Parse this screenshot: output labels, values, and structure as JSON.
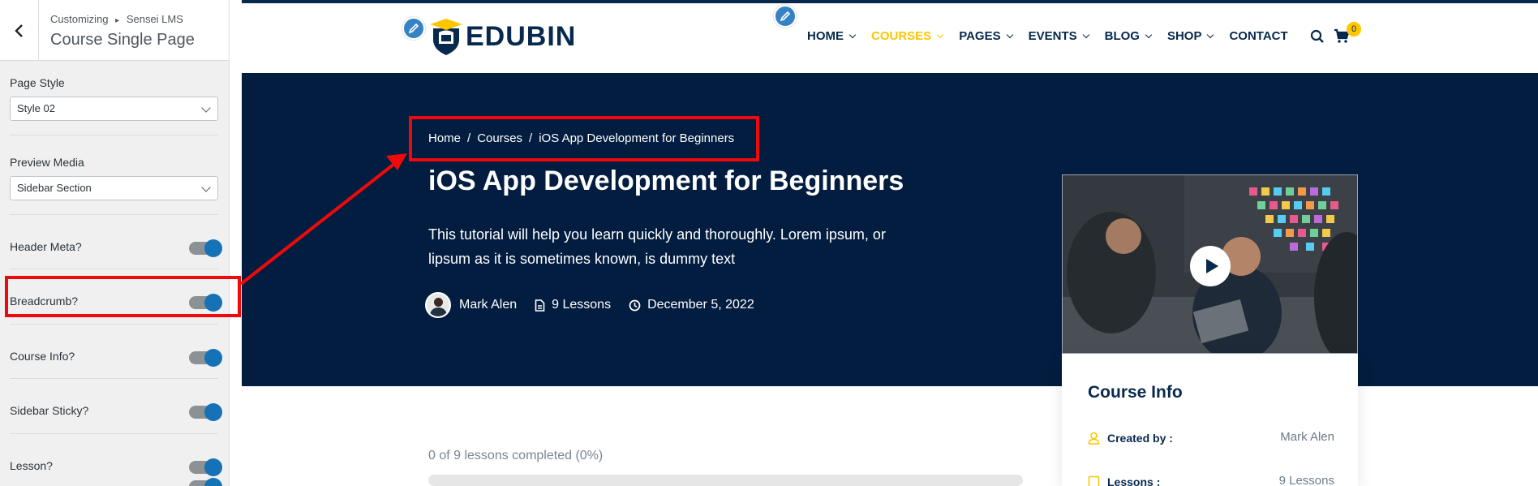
{
  "customizer": {
    "breadcrumb_parent": "Customizing",
    "breadcrumb_separator": "▸",
    "breadcrumb_section": "Sensei LMS",
    "title": "Course Single Page",
    "page_style": {
      "label": "Page Style",
      "value": "Style 02"
    },
    "preview_media": {
      "label": "Preview Media",
      "value": "Sidebar Section"
    },
    "toggles": [
      {
        "label": "Header Meta?",
        "on": true
      },
      {
        "label": "Breadcrumb?",
        "on": true
      },
      {
        "label": "Course Info?",
        "on": true
      },
      {
        "label": "Sidebar Sticky?",
        "on": true
      },
      {
        "label": "Lesson?",
        "on": true
      }
    ]
  },
  "site": {
    "logo_text": "EDUBIN",
    "nav": [
      {
        "label": "HOME",
        "dropdown": true,
        "active": false
      },
      {
        "label": "COURSES",
        "dropdown": true,
        "active": true
      },
      {
        "label": "PAGES",
        "dropdown": true,
        "active": false
      },
      {
        "label": "EVENTS",
        "dropdown": true,
        "active": false
      },
      {
        "label": "BLOG",
        "dropdown": true,
        "active": false
      },
      {
        "label": "SHOP",
        "dropdown": true,
        "active": false
      },
      {
        "label": "CONTACT",
        "dropdown": false,
        "active": false
      }
    ],
    "cart_count": "0",
    "breadcrumb": [
      "Home",
      "Courses",
      "iOS App Development for Beginners"
    ],
    "breadcrumb_separator": "/",
    "course_title": "iOS App Development for Beginners",
    "course_description": "This tutorial will help you learn quickly and thoroughly. Lorem ipsum, or lipsum as it is sometimes known, is dummy text",
    "meta": {
      "author": "Mark Alen",
      "lessons": "9 Lessons",
      "date": "December 5, 2022"
    },
    "course_info": {
      "title": "Course Info",
      "rows": [
        {
          "label": "Created by :",
          "value": "Mark Alen",
          "icon": "user-icon"
        },
        {
          "label": "Lessons :",
          "value": "9 Lessons",
          "icon": "book-icon"
        }
      ]
    },
    "progress": {
      "text": "0 of 9 lessons completed (0%)",
      "percent": 0
    }
  },
  "colors": {
    "navy": "#07294d",
    "hero_bg": "#021d3f",
    "accent_yellow": "#ffc600",
    "toggle_blue": "#1672b6",
    "annotation_red": "#ee0a0a"
  }
}
